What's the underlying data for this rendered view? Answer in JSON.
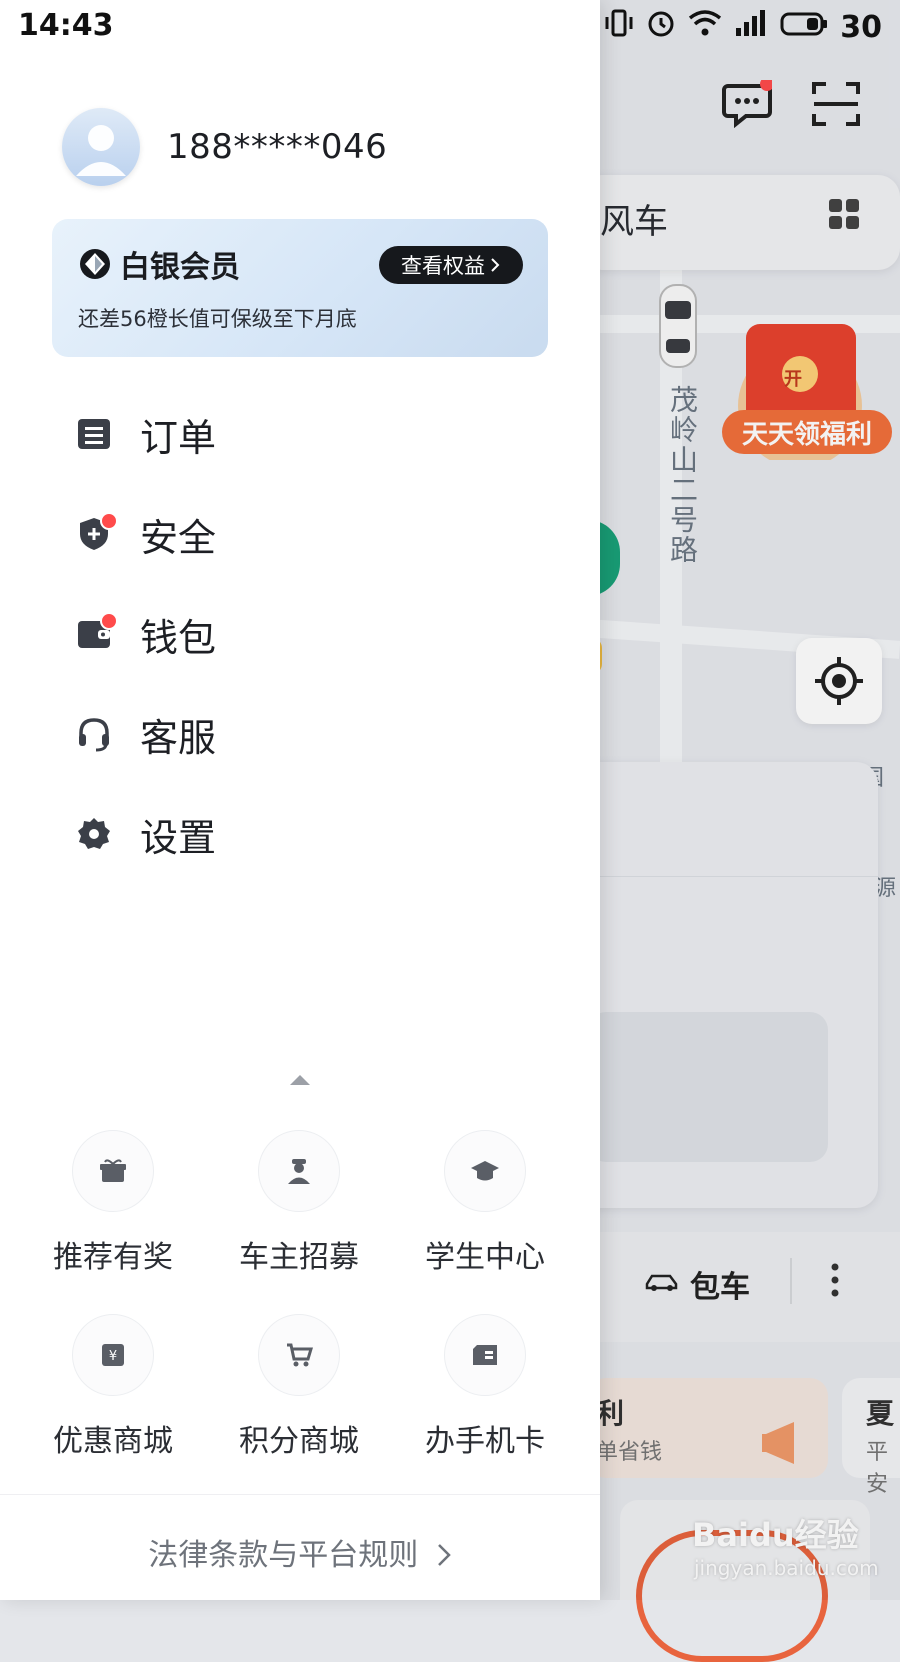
{
  "status_bar": {
    "time": "14:43",
    "battery": "30"
  },
  "profile": {
    "phone": "188*****046"
  },
  "membership": {
    "level": "白银会员",
    "subtitle": "还差56橙长值可保级至下月底",
    "button": "查看权益"
  },
  "menu": [
    {
      "label": "订单"
    },
    {
      "label": "安全"
    },
    {
      "label": "钱包"
    },
    {
      "label": "客服"
    },
    {
      "label": "设置"
    }
  ],
  "grid": [
    {
      "label": "推荐有奖",
      "icon": "gift-icon"
    },
    {
      "label": "车主招募",
      "icon": "driver-icon"
    },
    {
      "label": "学生中心",
      "icon": "graduation-cap-icon"
    },
    {
      "label": "优惠商城",
      "icon": "coupon-icon"
    },
    {
      "label": "积分商城",
      "icon": "cart-icon"
    },
    {
      "label": "办手机卡",
      "icon": "sim-card-icon"
    }
  ],
  "footer": {
    "link": "法律条款与平台规则"
  },
  "background": {
    "top_tab": "风车",
    "street": "茂岭山二号路",
    "promo": "天天领福利",
    "promo_badge": "开",
    "charter": "包车",
    "card_left_1": "利",
    "card_left_2": "单省钱",
    "card_right_1": "夏",
    "card_right_2": "平安",
    "map_label_1": "中国工",
    "map_label_2": "源"
  },
  "watermark": {
    "line1": "Baidu经验",
    "line2": "jingyan.baidu.com"
  }
}
